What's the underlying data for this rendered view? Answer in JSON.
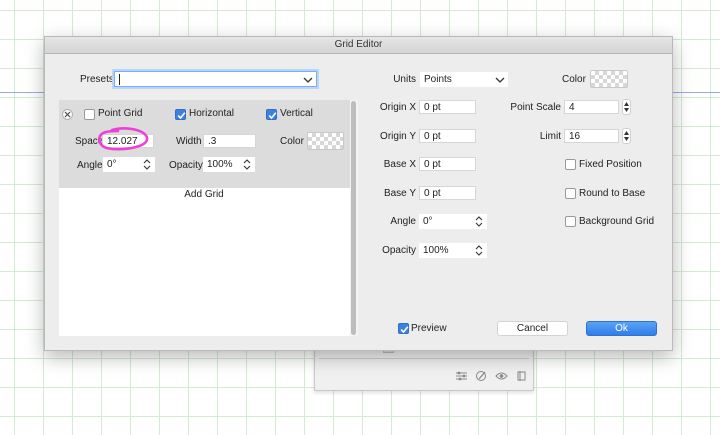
{
  "dialog": {
    "title": "Grid Editor"
  },
  "presets": {
    "label": "Presets",
    "value": ""
  },
  "grid_row": {
    "point_grid": {
      "label": "Point Grid",
      "checked": false
    },
    "horizontal": {
      "label": "Horizontal",
      "checked": true
    },
    "vertical": {
      "label": "Vertical",
      "checked": true
    },
    "space": {
      "label": "Space",
      "value": "12.027"
    },
    "width": {
      "label": "Width",
      "value": ".3"
    },
    "color": {
      "label": "Color"
    },
    "angle": {
      "label": "Angle",
      "value": "0°"
    },
    "opacity": {
      "label": "Opacity",
      "value": "100%"
    }
  },
  "add_grid_label": "Add Grid",
  "right": {
    "units": {
      "label": "Units",
      "value": "Points"
    },
    "color": {
      "label": "Color"
    },
    "origin_x": {
      "label": "Origin X",
      "value": "0 pt"
    },
    "origin_y": {
      "label": "Origin Y",
      "value": "0 pt"
    },
    "base_x": {
      "label": "Base X",
      "value": "0 pt"
    },
    "base_y": {
      "label": "Base Y",
      "value": "0 pt"
    },
    "angle": {
      "label": "Angle",
      "value": "0°"
    },
    "opacity": {
      "label": "Opacity",
      "value": "100%"
    },
    "point_scale": {
      "label": "Point Scale",
      "value": "4"
    },
    "limit": {
      "label": "Limit",
      "value": "16"
    },
    "fixed_position": {
      "label": "Fixed Position",
      "checked": false
    },
    "round_to_base": {
      "label": "Round to Base",
      "checked": false
    },
    "background_grid": {
      "label": "Background Grid",
      "checked": false
    }
  },
  "footer": {
    "preview": {
      "label": "Preview",
      "checked": true
    },
    "cancel_label": "Cancel",
    "ok_label": "Ok"
  },
  "colors": {
    "accent": "#3b82e0",
    "annotation": "#ee3fd6",
    "grid": "#d3ead3"
  },
  "icons": [
    "close-icon",
    "chevron-down-icon",
    "updown-arrows-icon",
    "checkmark-icon",
    "sliders-icon",
    "brush-icon",
    "eye-icon",
    "layer-icon"
  ]
}
